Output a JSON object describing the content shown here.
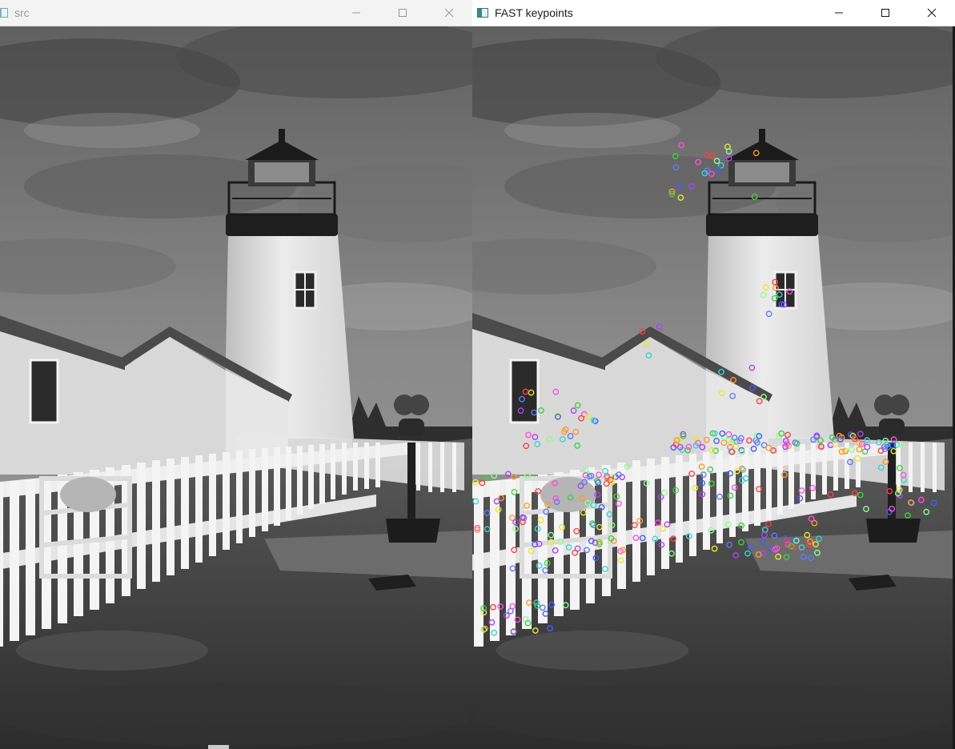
{
  "windows": {
    "src": {
      "title": "src",
      "icon": "app-window-icon"
    },
    "fast": {
      "title": "FAST keypoints",
      "icon": "app-window-icon"
    }
  },
  "controls": [
    "minimize-icon",
    "maximize-icon",
    "close-icon"
  ],
  "keypoint_colors": [
    "#ff4fd8",
    "#3fd13f",
    "#5a7dff",
    "#ff9a2a",
    "#3fd3d3",
    "#b040ff",
    "#e8e830",
    "#ff3f3f",
    "#8cff8c",
    "#4060ff"
  ]
}
